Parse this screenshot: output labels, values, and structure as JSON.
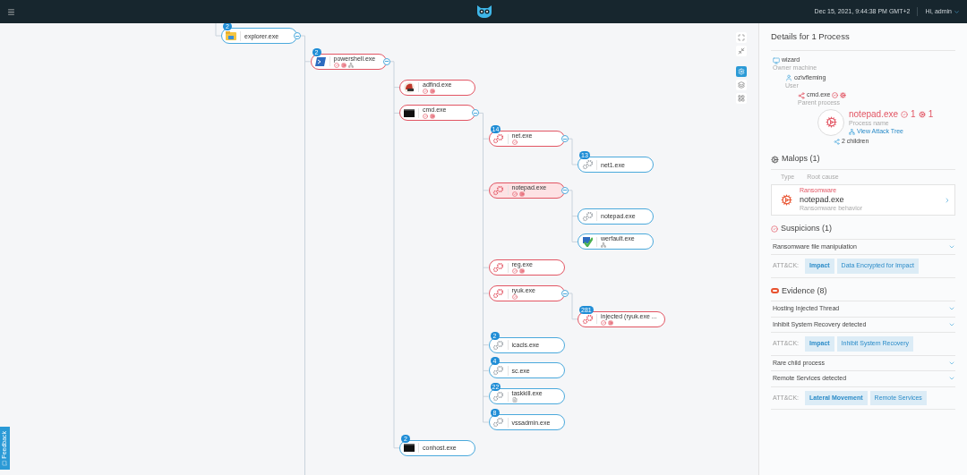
{
  "header": {
    "timestamp": "Dec 15, 2021, 9:44:38 PM GMT+2",
    "user": "Hi, admin"
  },
  "tree": {
    "kind": "explorer",
    "name": "explorer.exe",
    "malicious": false,
    "badge": "2",
    "selected": false,
    "expanded": true,
    "children": [
      {
        "kind": "powershell",
        "name": "powershell.exe",
        "malicious": true,
        "badge": "2",
        "selected": false,
        "expanded": true,
        "suspicion": true,
        "malop": true,
        "network": true,
        "children": [
          {
            "kind": "adfind",
            "name": "adfind.exe",
            "malicious": true,
            "selected": false,
            "suspicion": true,
            "malop": true
          },
          {
            "kind": "console",
            "name": "cmd.exe",
            "malicious": true,
            "selected": false,
            "expanded": true,
            "suspicion": true,
            "malop": true,
            "children": [
              {
                "kind": "gears",
                "name": "net.exe",
                "malicious": true,
                "badge": "14",
                "selected": false,
                "expanded": true,
                "suspicion": true,
                "children": [
                  {
                    "kind": "gears",
                    "name": "net1.exe",
                    "malicious": false,
                    "badge": "13",
                    "selected": false
                  }
                ]
              },
              {
                "kind": "gears",
                "name": "notepad.exe",
                "malicious": true,
                "selected": true,
                "expanded": true,
                "suspicion": true,
                "malop": true,
                "children": [
                  {
                    "kind": "gears",
                    "name": "notepad.exe",
                    "malicious": false,
                    "selected": false
                  },
                  {
                    "kind": "werfault",
                    "name": "werfault.exe",
                    "malicious": false,
                    "selected": false,
                    "network": true
                  }
                ]
              },
              {
                "kind": "gears",
                "name": "reg.exe",
                "malicious": true,
                "selected": false,
                "suspicion": true,
                "malop": true
              },
              {
                "kind": "gears",
                "name": "ryuk.exe",
                "malicious": true,
                "selected": false,
                "expanded": true,
                "suspicion": true,
                "children": [
                  {
                    "kind": "gears",
                    "name": "injected (ryuk.exe ...",
                    "malicious": true,
                    "badge": "281",
                    "selected": false,
                    "suspicion": true,
                    "malop": true
                  }
                ]
              },
              {
                "kind": "gears",
                "name": "icacls.exe",
                "malicious": false,
                "badge": "2",
                "selected": false
              },
              {
                "kind": "gears",
                "name": "sc.exe",
                "malicious": false,
                "badge": "4",
                "selected": false
              },
              {
                "kind": "gears",
                "name": "taskkill.exe",
                "malicious": false,
                "badge": "22",
                "selected": false,
                "file": true
              },
              {
                "kind": "gears",
                "name": "vssadmin.exe",
                "malicious": false,
                "badge": "8",
                "selected": false
              }
            ]
          },
          {
            "kind": "console",
            "name": "conhost.exe",
            "malicious": false,
            "badge": "2",
            "selected": false
          }
        ]
      }
    ]
  },
  "toolbar": [
    {
      "kind": "fullscreen",
      "selected": false
    },
    {
      "kind": "collapse",
      "selected": false
    },
    {
      "kind": "settings",
      "selected": true
    },
    {
      "kind": "layers",
      "selected": false
    },
    {
      "kind": "grid",
      "selected": false
    }
  ],
  "feedback": "Feedback",
  "details": {
    "title": "Details for 1 Process",
    "lineage": [
      {
        "kind": "machine",
        "value": "wizard",
        "label": "Owner machine"
      },
      {
        "kind": "user",
        "value": "oz\\vfleming",
        "label": "User"
      },
      {
        "kind": "parent",
        "value": "cmd.exe",
        "label": "Parent process",
        "suspicion": true,
        "malop": true
      }
    ],
    "process": {
      "name": "notepad.exe",
      "suspicions": "1",
      "malops": "1",
      "label": "Process name",
      "link": "View Attack Tree",
      "children": "2 children"
    },
    "malops": {
      "title": "Malops (1)",
      "columns": [
        "Type",
        "Root cause"
      ],
      "items": [
        {
          "type": "Ransomware",
          "name": "notepad.exe",
          "description": "Ransomware behavior"
        }
      ]
    },
    "suspicions": {
      "title": "Suspicions (1)",
      "items": [
        {
          "title": "Ransomware file manipulation",
          "attck_label": "ATT&CK:",
          "tags": [
            {
              "label": "Impact",
              "kind": "tactic"
            },
            {
              "label": "Data Encrypted for Impact",
              "kind": "technique"
            }
          ]
        }
      ]
    },
    "evidence": {
      "title": "Evidence (8)",
      "items": [
        {
          "title": "Hosting Injected Thread"
        },
        {
          "title": "Inhibit System Recovery detected",
          "attck_label": "ATT&CK:",
          "tags": [
            {
              "label": "Impact",
              "kind": "tactic"
            },
            {
              "label": "Inhibit System Recovery",
              "kind": "technique"
            }
          ]
        },
        {
          "title": "Rare child process"
        },
        {
          "title": "Remote Services detected",
          "attck_label": "ATT&CK:",
          "tags": [
            {
              "label": "Lateral Movement",
              "kind": "tactic"
            },
            {
              "label": "Remote Services",
              "kind": "technique"
            }
          ]
        }
      ]
    }
  }
}
